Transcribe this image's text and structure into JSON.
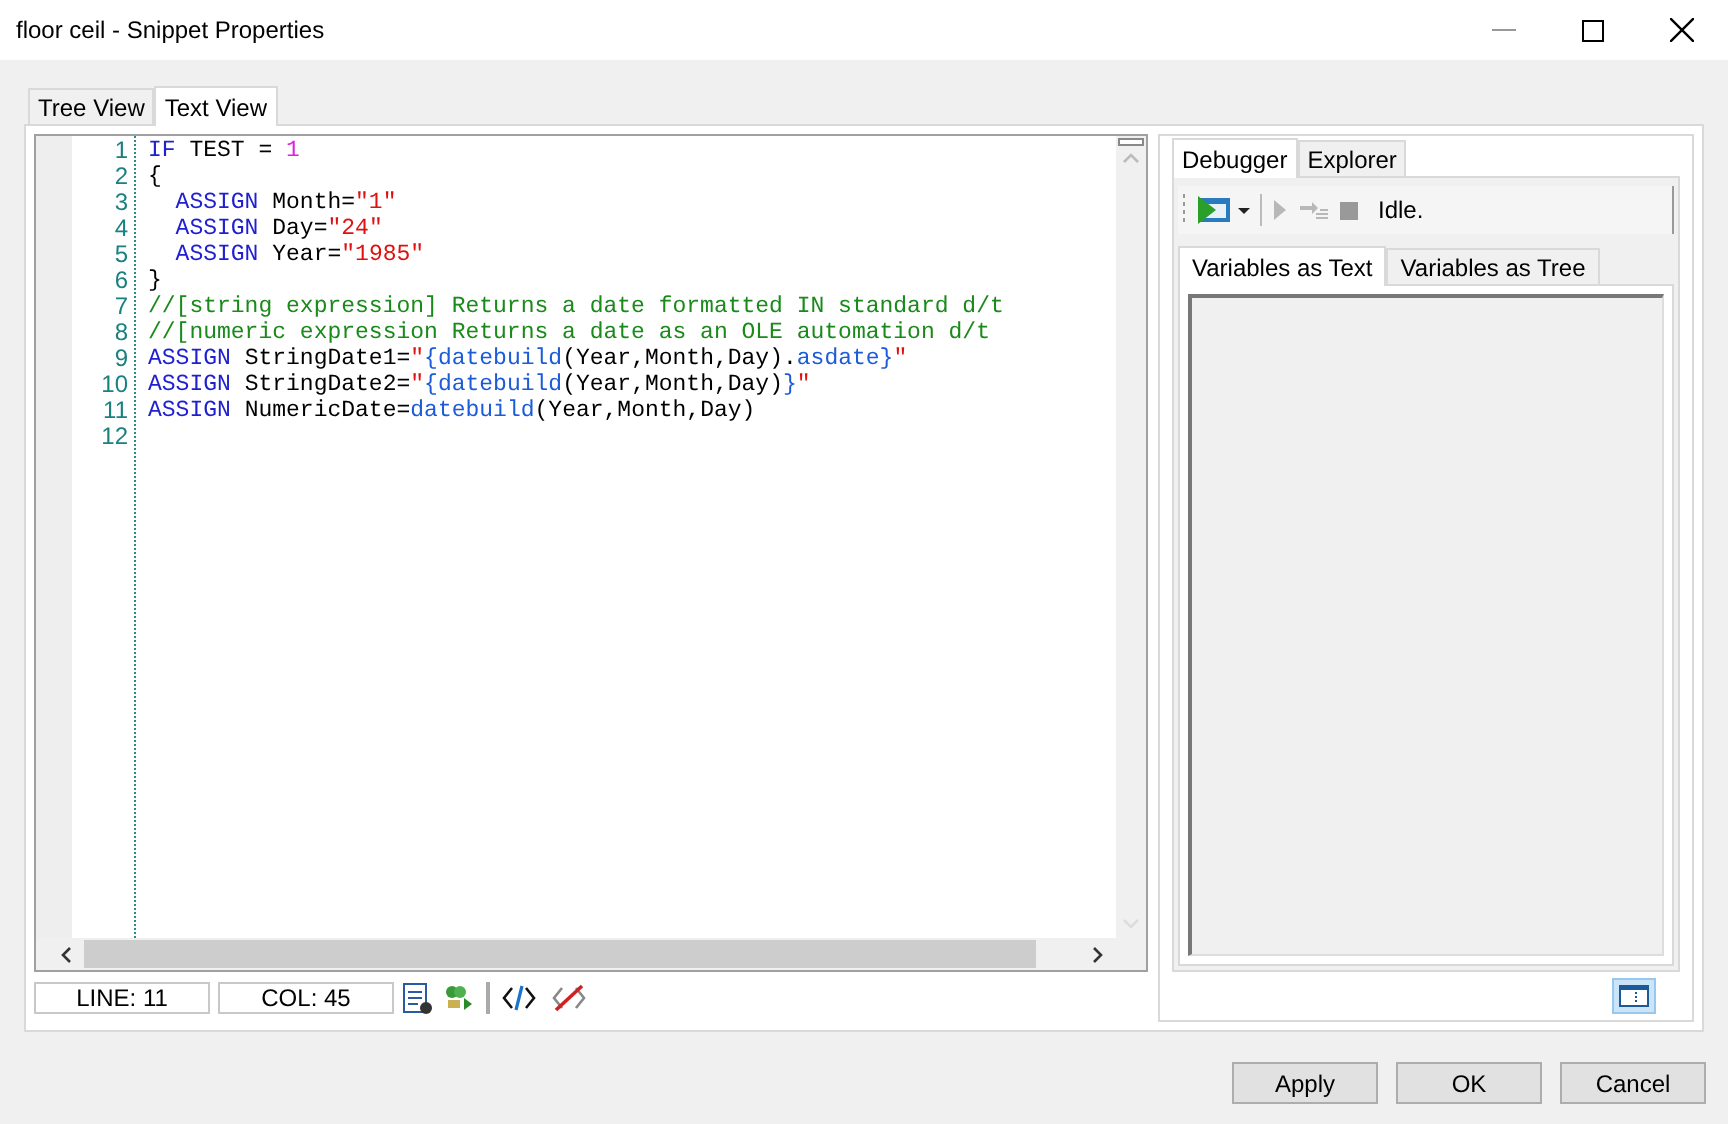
{
  "window": {
    "title": "floor ceil - Snippet Properties"
  },
  "tabs": [
    {
      "label": "Tree View",
      "selected": false
    },
    {
      "label": "Text View",
      "selected": true
    }
  ],
  "editor": {
    "lines": [
      {
        "number": "1",
        "tokens": [
          {
            "kind": "keyword",
            "text": "IF"
          },
          {
            "kind": "plain",
            "text": " TEST = "
          },
          {
            "kind": "number",
            "text": "1"
          }
        ]
      },
      {
        "number": "2",
        "tokens": [
          {
            "kind": "plain",
            "text": "{"
          }
        ]
      },
      {
        "number": "3",
        "tokens": [
          {
            "kind": "keyword",
            "text": "  ASSIGN"
          },
          {
            "kind": "plain",
            "text": " Month="
          },
          {
            "kind": "string",
            "text": "\"1\""
          }
        ]
      },
      {
        "number": "4",
        "tokens": [
          {
            "kind": "keyword",
            "text": "  ASSIGN"
          },
          {
            "kind": "plain",
            "text": " Day="
          },
          {
            "kind": "string",
            "text": "\"24\""
          }
        ]
      },
      {
        "number": "5",
        "tokens": [
          {
            "kind": "keyword",
            "text": "  ASSIGN"
          },
          {
            "kind": "plain",
            "text": " Year="
          },
          {
            "kind": "string",
            "text": "\"1985\""
          }
        ]
      },
      {
        "number": "6",
        "tokens": [
          {
            "kind": "plain",
            "text": "}"
          }
        ]
      },
      {
        "number": "7",
        "tokens": [
          {
            "kind": "comment",
            "text": "//[string expression] Returns a date formatted IN standard d/t"
          }
        ]
      },
      {
        "number": "8",
        "tokens": [
          {
            "kind": "comment",
            "text": "//[numeric expression Returns a date as an OLE automation d/t"
          }
        ]
      },
      {
        "number": "9",
        "tokens": [
          {
            "kind": "keyword",
            "text": "ASSIGN"
          },
          {
            "kind": "plain",
            "text": " StringDate1="
          },
          {
            "kind": "string",
            "text": "\""
          },
          {
            "kind": "function",
            "text": "{datebuild"
          },
          {
            "kind": "plain",
            "text": "(Year,Month,Day)."
          },
          {
            "kind": "function",
            "text": "asdate}"
          },
          {
            "kind": "string",
            "text": "\""
          }
        ]
      },
      {
        "number": "10",
        "tokens": [
          {
            "kind": "keyword",
            "text": "ASSIGN"
          },
          {
            "kind": "plain",
            "text": " StringDate2="
          },
          {
            "kind": "string",
            "text": "\""
          },
          {
            "kind": "function",
            "text": "{datebuild"
          },
          {
            "kind": "plain",
            "text": "(Year,Month,Day)"
          },
          {
            "kind": "function",
            "text": "}"
          },
          {
            "kind": "string",
            "text": "\""
          }
        ]
      },
      {
        "number": "11",
        "tokens": [
          {
            "kind": "keyword",
            "text": "ASSIGN"
          },
          {
            "kind": "plain",
            "text": " NumericDate="
          },
          {
            "kind": "function",
            "text": "datebuild"
          },
          {
            "kind": "plain",
            "text": "(Year,Month,Day)"
          }
        ]
      },
      {
        "number": "12"
      }
    ]
  },
  "status_bar": {
    "line": "LINE: 11",
    "col": "COL: 45"
  },
  "side_tabs": [
    {
      "label": "Debugger",
      "selected": true
    },
    {
      "label": "Explorer",
      "selected": false
    }
  ],
  "debugger": {
    "status": "Idle.",
    "tabs": [
      {
        "label": "Variables as Text",
        "selected": true
      },
      {
        "label": "Variables as Tree",
        "selected": false
      }
    ]
  },
  "buttons": [
    "Apply",
    "OK",
    "Cancel"
  ]
}
